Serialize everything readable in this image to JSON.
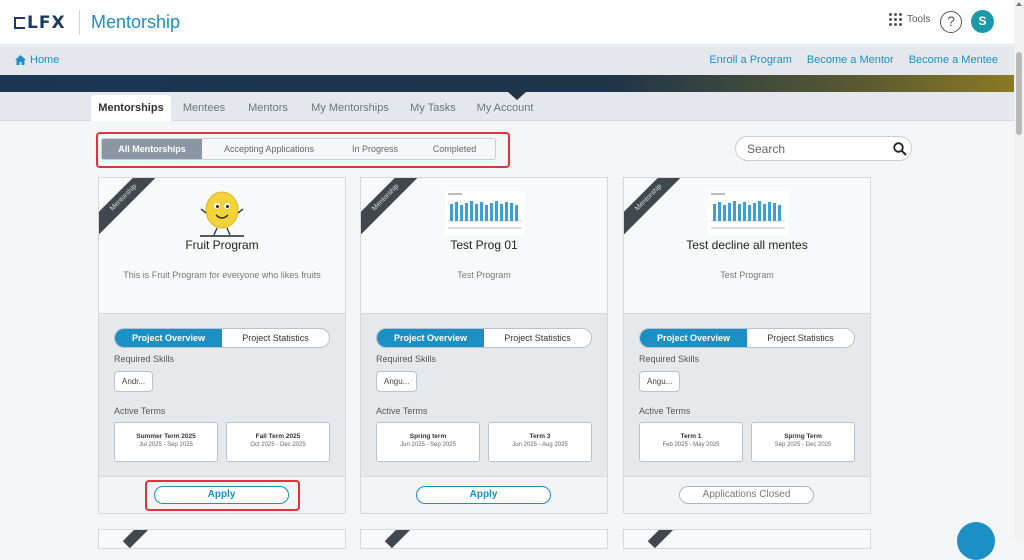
{
  "header": {
    "logo_text": "LFX",
    "app_title": "Mentorship",
    "tools_label": "Tools",
    "help_label": "?",
    "avatar_initial": "S"
  },
  "subnav": {
    "home_label": "Home",
    "links": [
      "Enroll a Program",
      "Become a Mentor",
      "Become a Mentee"
    ]
  },
  "tabs": [
    {
      "label": "Mentorships",
      "active": true
    },
    {
      "label": "Mentees",
      "active": false
    },
    {
      "label": "Mentors",
      "active": false
    },
    {
      "label": "My Mentorships",
      "active": false
    },
    {
      "label": "My Tasks",
      "active": false
    },
    {
      "label": "My Account",
      "active": false
    }
  ],
  "filters": [
    {
      "label": "All Mentorships",
      "active": true
    },
    {
      "label": "Accepting Applications",
      "active": false
    },
    {
      "label": "In Progress",
      "active": false
    },
    {
      "label": "Completed",
      "active": false
    }
  ],
  "search": {
    "placeholder": "Search"
  },
  "cards": [
    {
      "ribbon": "Mentorship",
      "title": "Fruit Program",
      "description": "This is Fruit Program for everyone who likes fruits",
      "toggle_active": "Project Overview",
      "toggle_inactive": "Project Statistics",
      "skills_label": "Required Skills",
      "skill": "Andr...",
      "terms_label": "Active Terms",
      "terms": [
        {
          "name": "Summer Term 2025",
          "dates": "Jul 2025 - Sep 2025"
        },
        {
          "name": "Fall Term 2025",
          "dates": "Oct 2025 - Dec 2025"
        }
      ],
      "action": "Apply",
      "action_enabled": true
    },
    {
      "ribbon": "Mentorship",
      "title": "Test Prog 01",
      "description": "Test Program",
      "toggle_active": "Project Overview",
      "toggle_inactive": "Project Statistics",
      "skills_label": "Required Skills",
      "skill": "Angu...",
      "terms_label": "Active Terms",
      "terms": [
        {
          "name": "Spring term",
          "dates": "Jun 2025 - Sep 2025"
        },
        {
          "name": "Term 3",
          "dates": "Jun 2025 - Aug 2025"
        }
      ],
      "action": "Apply",
      "action_enabled": true
    },
    {
      "ribbon": "Mentorship",
      "title": "Test decline all mentes",
      "description": "Test Program",
      "toggle_active": "Project Overview",
      "toggle_inactive": "Project Statistics",
      "skills_label": "Required Skills",
      "skill": "Angu...",
      "terms_label": "Active Terms",
      "terms": [
        {
          "name": "Term 1",
          "dates": "Feb 2025 - May 2025"
        },
        {
          "name": "Spring Term",
          "dates": "Sep 2025 - Dec 2025"
        }
      ],
      "action": "Applications Closed",
      "action_enabled": false
    }
  ],
  "colors": {
    "accent": "#1c8fc4",
    "highlight": "#e0323b",
    "ribbon": "#40474f"
  }
}
